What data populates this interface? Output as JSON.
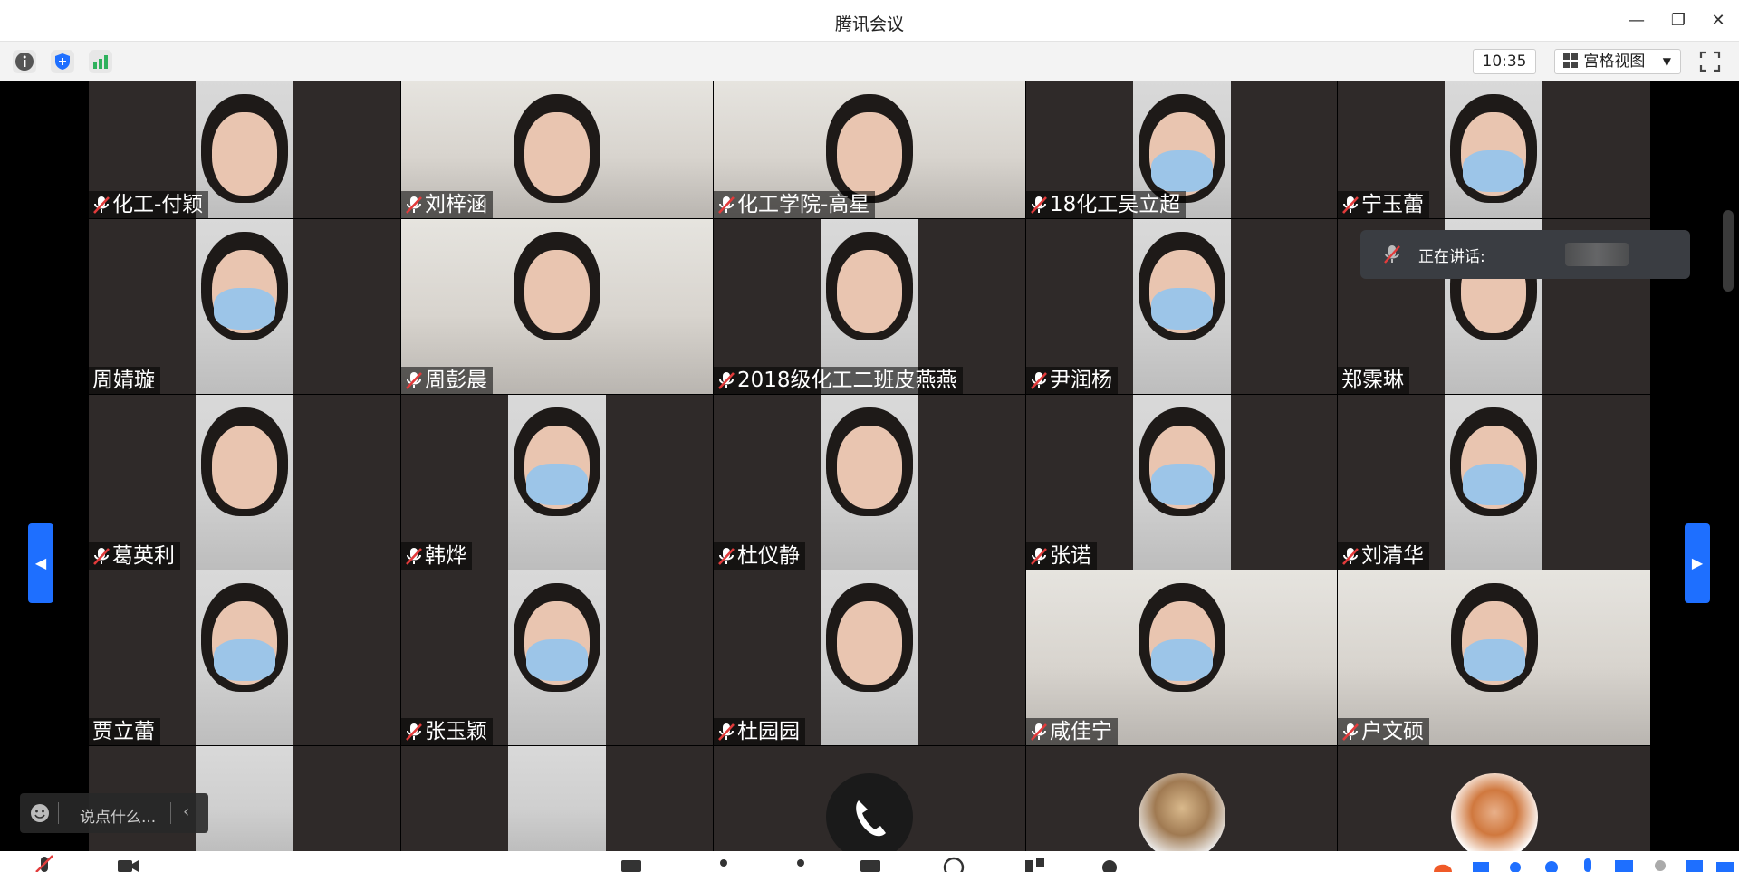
{
  "window": {
    "title": "腾讯会议"
  },
  "toolbar": {
    "time": "10:35",
    "view_label": "宫格视图"
  },
  "speaking": {
    "label": "正在讲话:"
  },
  "chat": {
    "placeholder": "说点什么..."
  },
  "participants": [
    {
      "name": "化工-付颖",
      "muted": true
    },
    {
      "name": "刘梓涵",
      "muted": true
    },
    {
      "name": "化工学院-高星",
      "muted": true
    },
    {
      "name": "18化工吴立超",
      "muted": true
    },
    {
      "name": "宁玉蕾",
      "muted": true
    },
    {
      "name": "周婧璇",
      "muted": false
    },
    {
      "name": "周彭晨",
      "muted": true
    },
    {
      "name": "2018级化工二班皮燕燕",
      "muted": true
    },
    {
      "name": "尹润杨",
      "muted": true
    },
    {
      "name": "郑霂琳",
      "muted": false
    },
    {
      "name": "葛英利",
      "muted": true
    },
    {
      "name": "韩烨",
      "muted": true
    },
    {
      "name": "杜仪静",
      "muted": true
    },
    {
      "name": "张诺",
      "muted": true
    },
    {
      "name": "刘清华",
      "muted": true
    },
    {
      "name": "贾立蕾",
      "muted": false
    },
    {
      "name": "张玉颖",
      "muted": true
    },
    {
      "name": "杜园园",
      "muted": true
    },
    {
      "name": "咸佳宁",
      "muted": true
    },
    {
      "name": "户文硕",
      "muted": true
    }
  ],
  "colors": {
    "accent": "#1e6fff",
    "tile_bg": "#2f2a29",
    "mute_red": "#e23b3b"
  },
  "icons": [
    "info-icon",
    "shield-icon",
    "signal-icon",
    "grid-view-icon",
    "fullscreen-icon",
    "emoji-icon",
    "mic-muted-icon",
    "phone-icon"
  ]
}
